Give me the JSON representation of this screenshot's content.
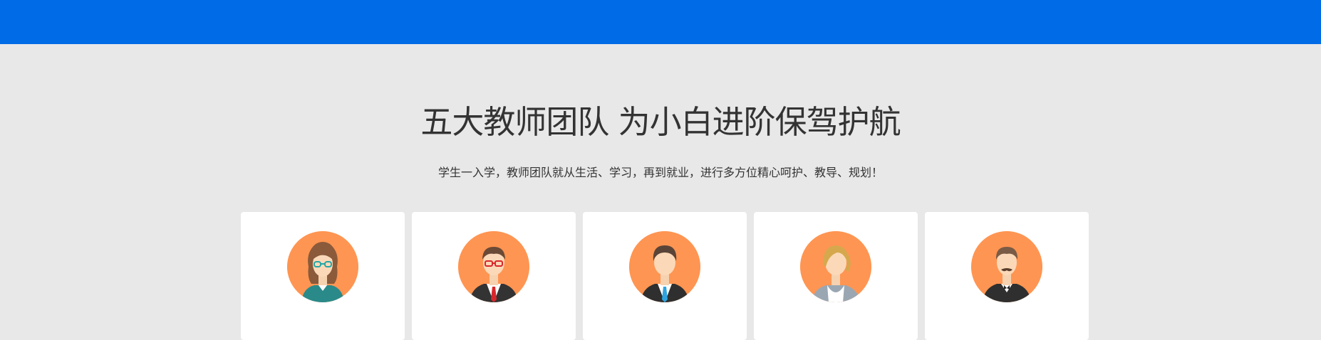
{
  "header": {
    "accent": "#006be6"
  },
  "section": {
    "title": "五大教师团队 为小白进阶保驾护航",
    "subtitle": "学生一入学，教师团队就从生活、学习，再到就业，进行多方位精心呵护、教导、规划！"
  },
  "teachers": [
    {
      "icon": "female-teacher-glasses-avatar"
    },
    {
      "icon": "male-teacher-red-tie-avatar"
    },
    {
      "icon": "male-teacher-blue-tie-avatar"
    },
    {
      "icon": "female-teacher-blonde-avatar"
    },
    {
      "icon": "male-teacher-mustache-avatar"
    }
  ],
  "colors": {
    "avatar_bg": "#ff9552",
    "page_bg": "#e8e8e8",
    "card_bg": "#ffffff"
  }
}
